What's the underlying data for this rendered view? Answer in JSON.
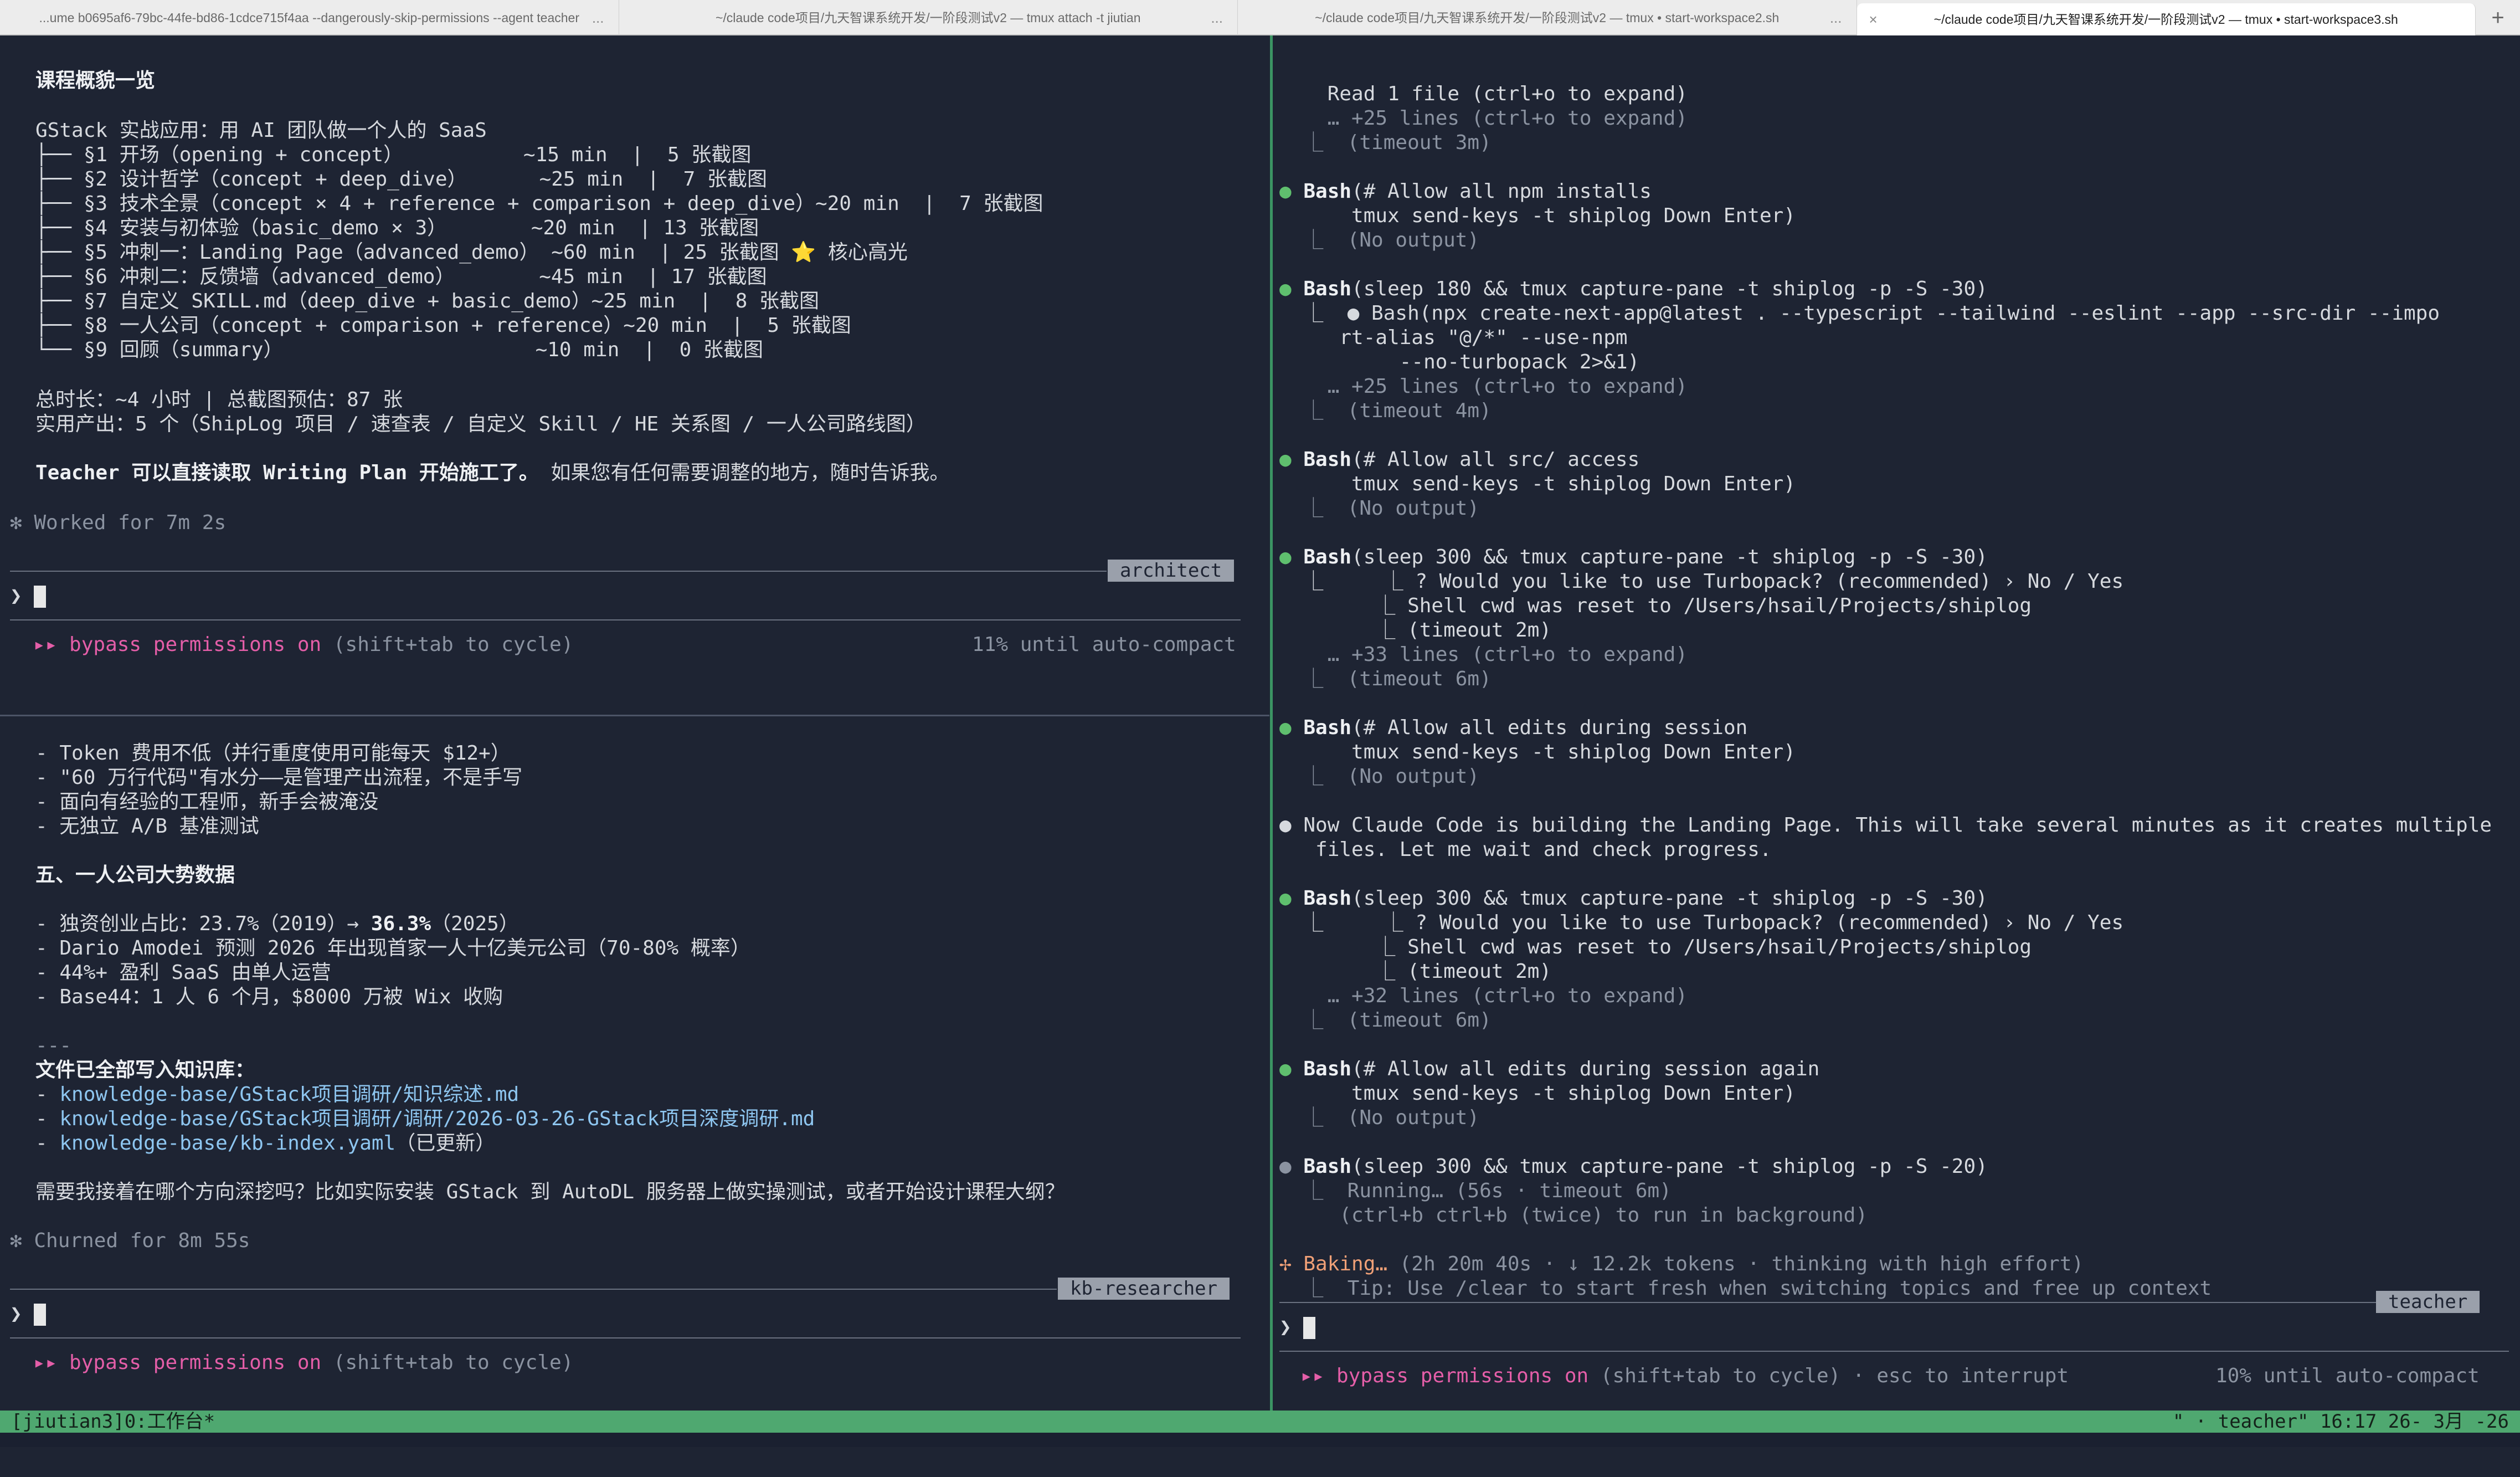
{
  "tabs": [
    {
      "label": "...ume b0695af6-79bc-44fe-bd86-1cdce715f4aa --dangerously-skip-permissions --agent teacher",
      "more": "...",
      "active": false
    },
    {
      "label": "~/claude code项目/九天智课系统开发/一阶段测试v2 — tmux attach -t jiutian",
      "more": "...",
      "active": false
    },
    {
      "label": "~/claude code项目/九天智课系统开发/一阶段测试v2 — tmux • start-workspace2.sh",
      "more": "...",
      "active": false
    },
    {
      "label": "~/claude code项目/九天智课系统开发/一阶段测试v2 — tmux • start-workspace3.sh",
      "close": "×",
      "active": true
    }
  ],
  "new_tab": "+",
  "architect": {
    "heading": "课程概貌一览",
    "course_title": "GStack 实战应用：用 AI 团队做一个人的 SaaS",
    "sections": [
      "├── §1 开场（opening + concept）          ~15 min  |  5 张截图",
      "├── §2 设计哲学（concept + deep_dive）      ~25 min  |  7 张截图",
      "├── §3 技术全景（concept × 4 + reference + comparison + deep_dive）~20 min  |  7 张截图",
      "├── §4 安装与初体验（basic_demo × 3）       ~20 min  | 13 张截图",
      "├── §5 冲刺一：Landing Page（advanced_demo） ~60 min  | 25 张截图 ⭐ 核心高光",
      "├── §6 冲刺二：反馈墙（advanced_demo）       ~45 min  | 17 张截图",
      "├── §7 自定义 SKILL.md（deep_dive + basic_demo）~25 min  |  8 张截图",
      "├── §8 一人公司（concept + comparison + reference）~20 min  |  5 张截图",
      "└── §9 回顾（summary）                     ~10 min  |  0 张截图"
    ],
    "totals": "总时长：~4 小时 | 总截图预估：87 张",
    "outputs": "实用产出：5 个（ShipLog 项目 / 速查表 / 自定义 Skill / HE 关系图 / 一人公司路线图）",
    "closing_bold": "Teacher 可以直接读取 Writing Plan 开始施工了。",
    "closing_rest": " 如果您有任何需要调整的地方，随时告诉我。",
    "worked": "✻ Worked for 7m 2s",
    "agent_label": "architect",
    "prompt": "❯",
    "bypass_arrows": "▸▸",
    "bypass_text": "bypass permissions on",
    "bypass_hint": " (shift+tab to cycle)",
    "autocompact": "11% until auto-compact"
  },
  "kb": {
    "bullets_top": [
      "- Token 费用不低（并行重度使用可能每天 $12+）",
      "- \"60 万行代码\"有水分——是管理产出流程，不是手写",
      "- 面向有经验的工程师，新手会被淹没",
      "- 无独立 A/B 基准测试"
    ],
    "section5": "五、一人公司大势数据",
    "stat1_pre": "- 独资创业占比：23.7%（2019）→ ",
    "stat1_bold": "36.3%",
    "stat1_post": "（2025）",
    "stat2": "- Dario Amodei 预测 2026 年出现首家一人十亿美元公司（70-80% 概率）",
    "stat3": "- 44%+ 盈利 SaaS 由单人运营",
    "stat4": "- Base44：1 人 6 个月，$8000 万被 Wix 收购",
    "rule": "---",
    "kb_written": "文件已全部写入知识库：",
    "files": [
      {
        "dash": "- ",
        "path": "knowledge-base/GStack项目调研/知识综述.md",
        "note": ""
      },
      {
        "dash": "- ",
        "path": "knowledge-base/GStack项目调研/调研/2026-03-26-GStack项目深度调研.md",
        "note": ""
      },
      {
        "dash": "- ",
        "path": "knowledge-base/kb-index.yaml",
        "note": "（已更新）"
      }
    ],
    "question": "需要我接着在哪个方向深挖吗？比如实际安装 GStack 到 AutoDL 服务器上做实操测试，或者开始设计课程大纲？",
    "churned": "✻ Churned for 8m 55s",
    "agent_label": "kb-researcher",
    "prompt": "❯",
    "bypass_arrows": "▸▸",
    "bypass_text": "bypass permissions on",
    "bypass_hint": " (shift+tab to cycle)"
  },
  "teacher": {
    "lines": [
      {
        "t": "indent",
        "text": "    Read 1 file (ctrl+o to expand)"
      },
      {
        "t": "dimindent",
        "text": "    … +25 lines (ctrl+o to expand)"
      },
      {
        "t": "sub",
        "text": "  ⎿  (timeout 3m)"
      },
      {
        "t": "blank"
      },
      {
        "t": "tool",
        "dot": "●",
        "name": "Bash",
        "args": "(# Allow all npm installs"
      },
      {
        "t": "indent",
        "text": "      tmux send-keys -t shiplog Down Enter)"
      },
      {
        "t": "sub",
        "text": "  ⎿  (No output)"
      },
      {
        "t": "blank"
      },
      {
        "t": "tool",
        "dot": "●",
        "name": "Bash",
        "args": "(sleep 180 && tmux capture-pane -t shiplog -p -S -30)"
      },
      {
        "t": "indent",
        "text": "  ⎿  ● Bash(npx create-next-app@latest . --typescript --tailwind --eslint --app --src-dir --impo"
      },
      {
        "t": "indent",
        "text": "     rt-alias \"@/*\" --use-npm"
      },
      {
        "t": "indent",
        "text": "          --no-turbopack 2>&1)"
      },
      {
        "t": "dimindent",
        "text": "    … +25 lines (ctrl+o to expand)"
      },
      {
        "t": "sub",
        "text": "  ⎿  (timeout 4m)"
      },
      {
        "t": "blank"
      },
      {
        "t": "tool",
        "dot": "●",
        "name": "Bash",
        "args": "(# Allow all src/ access"
      },
      {
        "t": "indent",
        "text": "      tmux send-keys -t shiplog Down Enter)"
      },
      {
        "t": "sub",
        "text": "  ⎿  (No output)"
      },
      {
        "t": "blank"
      },
      {
        "t": "tool",
        "dot": "●",
        "name": "Bash",
        "args": "(sleep 300 && tmux capture-pane -t shiplog -p -S -30)"
      },
      {
        "t": "indent",
        "text": "  ⎿     ⎿ ? Would you like to use Turbopack? (recommended) › No / Yes"
      },
      {
        "t": "indent",
        "text": "        ⎿ Shell cwd was reset to /Users/hsail/Projects/shiplog"
      },
      {
        "t": "indent",
        "text": "        ⎿ (timeout 2m)"
      },
      {
        "t": "dimindent",
        "text": "    … +33 lines (ctrl+o to expand)"
      },
      {
        "t": "sub",
        "text": "  ⎿  (timeout 6m)"
      },
      {
        "t": "blank"
      },
      {
        "t": "tool",
        "dot": "●",
        "name": "Bash",
        "args": "(# Allow all edits during session"
      },
      {
        "t": "indent",
        "text": "      tmux send-keys -t shiplog Down Enter)"
      },
      {
        "t": "sub",
        "text": "  ⎿  (No output)"
      },
      {
        "t": "blank"
      },
      {
        "t": "msg",
        "dot": "●",
        "text": " Now Claude Code is building the Landing Page. This will take several minutes as it creates multiple"
      },
      {
        "t": "indent",
        "text": "   files. Let me wait and check progress."
      },
      {
        "t": "blank"
      },
      {
        "t": "tool",
        "dot": "●",
        "name": "Bash",
        "args": "(sleep 300 && tmux capture-pane -t shiplog -p -S -30)"
      },
      {
        "t": "indent",
        "text": "  ⎿     ⎿ ? Would you like to use Turbopack? (recommended) › No / Yes"
      },
      {
        "t": "indent",
        "text": "        ⎿ Shell cwd was reset to /Users/hsail/Projects/shiplog"
      },
      {
        "t": "indent",
        "text": "        ⎿ (timeout 2m)"
      },
      {
        "t": "dimindent",
        "text": "    … +32 lines (ctrl+o to expand)"
      },
      {
        "t": "sub",
        "text": "  ⎿  (timeout 6m)"
      },
      {
        "t": "blank"
      },
      {
        "t": "tool",
        "dot": "●",
        "name": "Bash",
        "args": "(# Allow all edits during session again"
      },
      {
        "t": "indent",
        "text": "      tmux send-keys -t shiplog Down Enter)"
      },
      {
        "t": "sub",
        "text": "  ⎿  (No output)"
      },
      {
        "t": "blank"
      },
      {
        "t": "toolgray",
        "dot": "●",
        "name": "Bash",
        "args": "(sleep 300 && tmux capture-pane -t shiplog -p -S -20)"
      },
      {
        "t": "sub",
        "text": "  ⎿  Running… (56s · timeout 6m)"
      },
      {
        "t": "sub",
        "text": "     (ctrl+b ctrl+b (twice) to run in background)"
      },
      {
        "t": "blank"
      },
      {
        "t": "baking",
        "star": "✢",
        "word": " Baking…",
        "rest": " (2h 20m 40s · ↓ 12.2k tokens · thinking with high effort)"
      },
      {
        "t": "sub",
        "text": "  ⎿  Tip: Use /clear to start fresh when switching topics and free up context"
      }
    ],
    "agent_label": "teacher",
    "prompt": "❯",
    "bypass_arrows": "▸▸",
    "bypass_text": "bypass permissions on",
    "bypass_hint": " (shift+tab to cycle) · esc to interrupt",
    "autocompact": "10% until auto-compact"
  },
  "statusbar": {
    "left": "[jiutian3]0:工作台*",
    "right": "\" · teacher\" 16:17 26- 3月 -26"
  },
  "colors": {
    "background": "#1e2433",
    "accent_green": "#4fa870",
    "bullet_green": "#5fbf6e",
    "bypass_pink": "#e45ea8",
    "baking_peach": "#f0a077",
    "link_blue": "#8ec6f0"
  }
}
